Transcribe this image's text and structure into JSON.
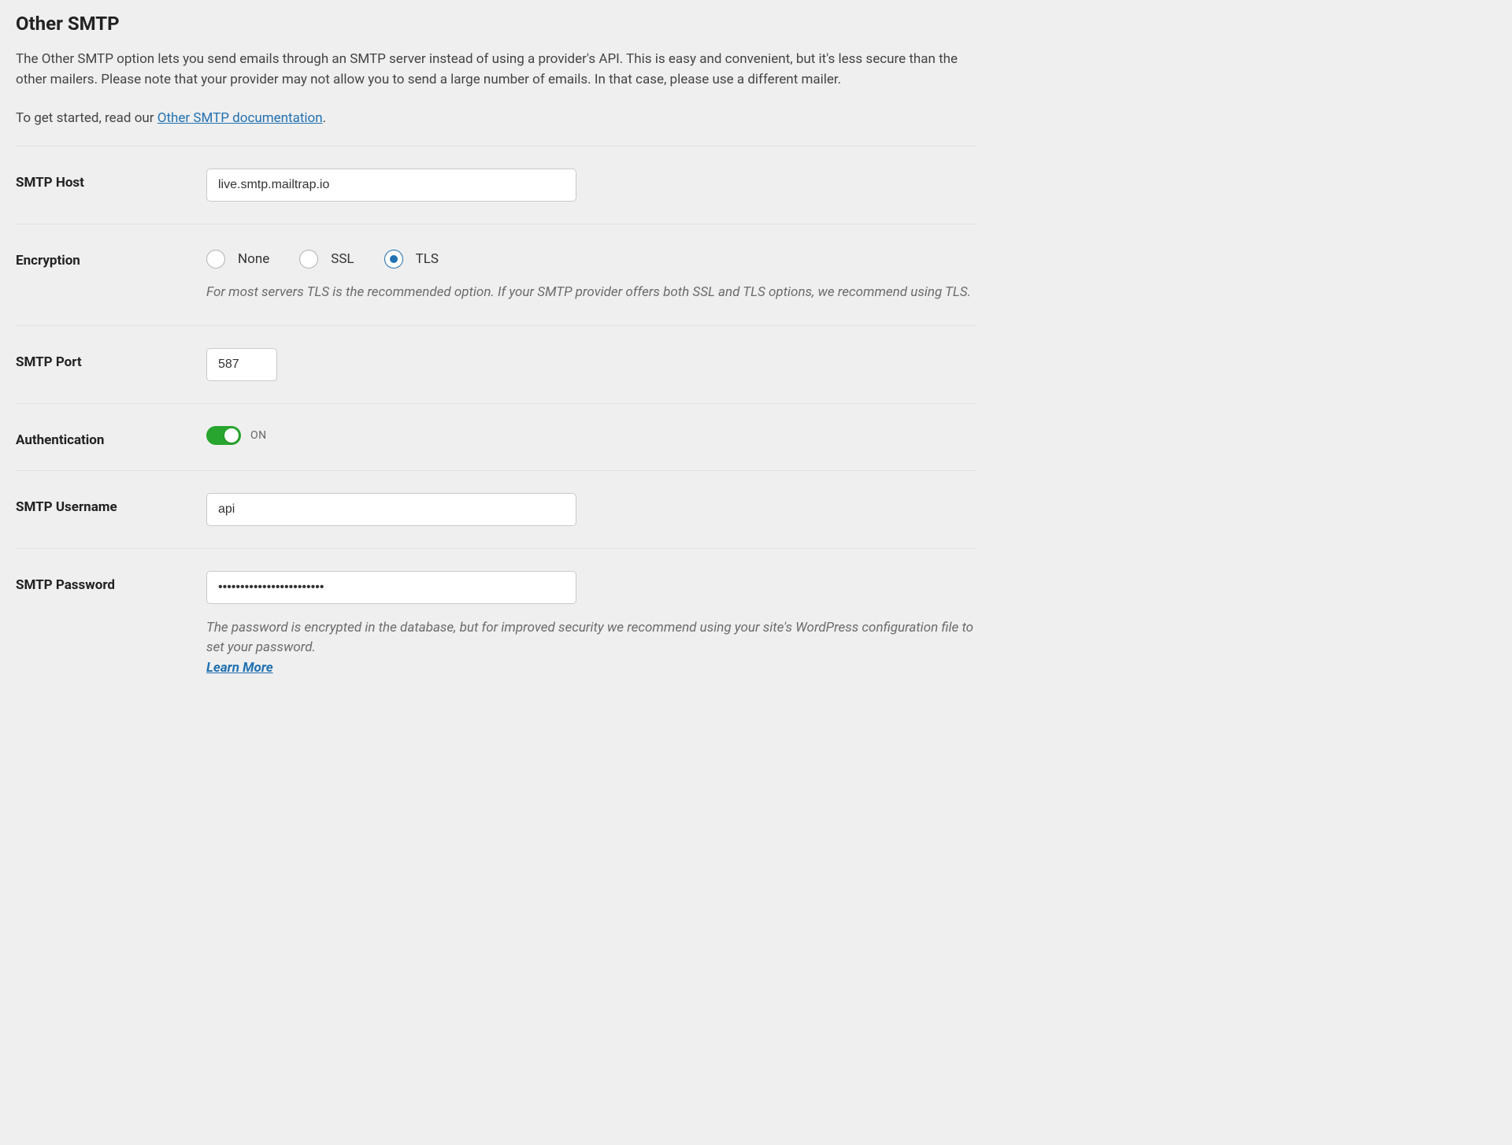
{
  "header": {
    "title": "Other SMTP",
    "description": "The Other SMTP option lets you send emails through an SMTP server instead of using a provider's API. This is easy and convenient, but it's less secure than the other mailers. Please note that your provider may not allow you to send a large number of emails. In that case, please use a different mailer.",
    "cta_prefix": "To get started, read our ",
    "cta_link": "Other SMTP documentation",
    "cta_suffix": "."
  },
  "fields": {
    "smtp_host": {
      "label": "SMTP Host",
      "value": "live.smtp.mailtrap.io"
    },
    "encryption": {
      "label": "Encryption",
      "options": {
        "none": "None",
        "ssl": "SSL",
        "tls": "TLS"
      },
      "selected": "tls",
      "help": "For most servers TLS is the recommended option. If your SMTP provider offers both SSL and TLS options, we recommend using TLS."
    },
    "smtp_port": {
      "label": "SMTP Port",
      "value": "587"
    },
    "authentication": {
      "label": "Authentication",
      "state": "ON",
      "enabled": true
    },
    "smtp_username": {
      "label": "SMTP Username",
      "value": "api"
    },
    "smtp_password": {
      "label": "SMTP Password",
      "value": "••••••••••••••••••••••••",
      "help": "The password is encrypted in the database, but for improved security we recommend using your site's WordPress configuration file to set your password.",
      "learn_more": "Learn More"
    }
  }
}
